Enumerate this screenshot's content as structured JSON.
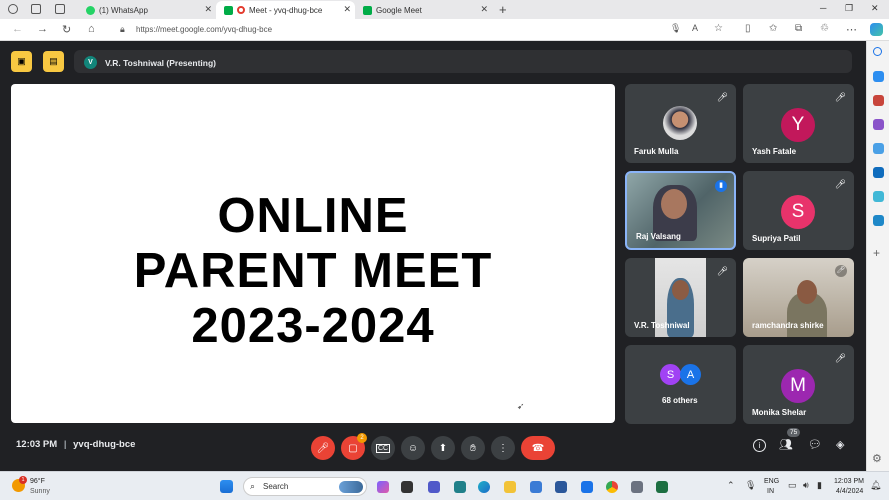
{
  "browser": {
    "tabs": [
      {
        "label": "(1) WhatsApp",
        "color": "#25d366"
      },
      {
        "label": "Meet - yvq-dhug-bce",
        "color": "#e33b2e"
      },
      {
        "label": "Google Meet",
        "color": "#00ac47"
      }
    ],
    "new_tab": "+",
    "url": "https://meet.google.com/yvq-dhug-bce",
    "window_controls": [
      "minimize-icon",
      "restore-icon",
      "close-icon"
    ]
  },
  "meet": {
    "presenter_initial": "V",
    "presenter_label": "V.R. Toshniwal (Presenting)",
    "slide": {
      "line1": "ONLINE",
      "line2": "PARENT MEET",
      "line3": "2023-2024"
    },
    "participants": [
      {
        "name": "Faruk Mulla",
        "type": "photo",
        "muted": true
      },
      {
        "name": "Yash Fatale",
        "initial": "Y",
        "color": "#c2185b",
        "muted": true
      },
      {
        "name": "Raj Valsang",
        "type": "video",
        "speaking": true
      },
      {
        "name": "Supriya Patil",
        "initial": "S",
        "color": "#e8336b",
        "muted": true
      },
      {
        "name": "V.R. Toshniwal",
        "type": "video",
        "muted": true
      },
      {
        "name": "ramchandra shirke",
        "type": "video",
        "muted": true
      },
      {
        "name": "68 others",
        "initials": [
          "S",
          "A"
        ],
        "colors": [
          "#a142f4",
          "#1a73e8"
        ]
      },
      {
        "name": "Monika Shelar",
        "initial": "M",
        "color": "#9c27b0",
        "muted": true
      }
    ],
    "time": "12:03 PM",
    "separator": "|",
    "meeting_code": "yvq-dhug-bce",
    "people_count": "75",
    "reaction_badge": "2"
  },
  "taskbar": {
    "weather_temp": "96°F",
    "weather_desc": "Sunny",
    "weather_badge": "1",
    "search_placeholder": "Search",
    "lang_line1": "ENG",
    "lang_line2": "IN",
    "clock_time": "12:03 PM",
    "clock_date": "4/4/2024"
  }
}
